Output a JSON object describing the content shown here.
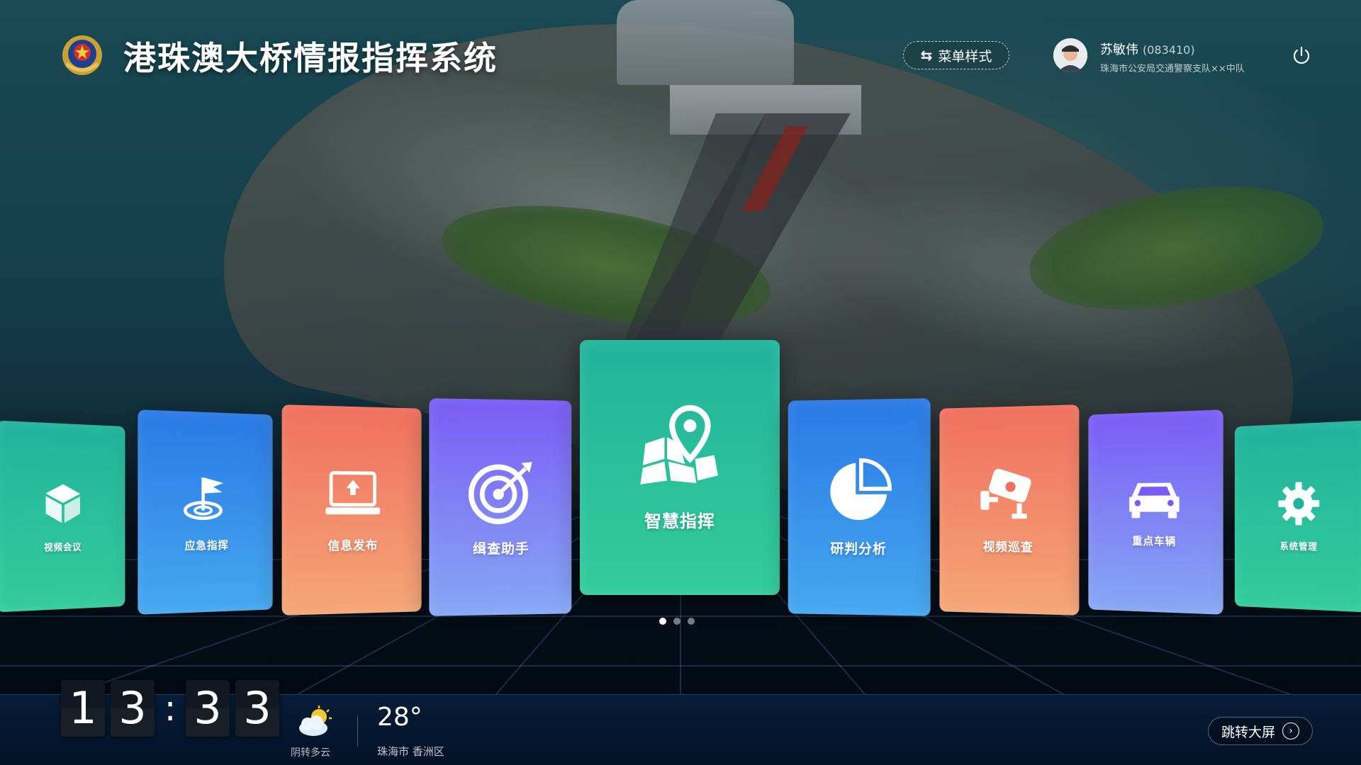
{
  "header": {
    "title": "港珠澳大桥情报指挥系统",
    "menu_style_label": "菜单样式",
    "user": {
      "name": "苏敏伟",
      "id": "(083410)",
      "department": "珠海市公安局交通警察支队××中队"
    }
  },
  "cards": [
    {
      "label": "视频会议",
      "icon": "cube-icon",
      "color": "#21b39c"
    },
    {
      "label": "应急指挥",
      "icon": "flag-target-icon",
      "color": "#2a79e4"
    },
    {
      "label": "信息发布",
      "icon": "laptop-upload-icon",
      "color": "#f0705e"
    },
    {
      "label": "缉查助手",
      "icon": "target-icon",
      "color": "#7a5cf5"
    },
    {
      "label": "智慧指挥",
      "icon": "map-pin-icon",
      "color": "#21b39c"
    },
    {
      "label": "研判分析",
      "icon": "pie-chart-icon",
      "color": "#2a79e4"
    },
    {
      "label": "视频巡查",
      "icon": "cctv-camera-icon",
      "color": "#f0705e"
    },
    {
      "label": "重点车辆",
      "icon": "car-icon",
      "color": "#7a5cf5"
    },
    {
      "label": "系统管理",
      "icon": "gear-icon",
      "color": "#21b39c"
    }
  ],
  "pagination": {
    "pages": 3,
    "active": 1
  },
  "clock": {
    "digits": [
      "1",
      "3",
      "3",
      "3"
    ],
    "separator": ":"
  },
  "weather": {
    "description": "阴转多云",
    "temperature": "28°",
    "location": "珠海市 香洲区",
    "icon": "cloudy-sun-icon"
  },
  "jump_button": {
    "label": "跳转大屏"
  },
  "colors": {
    "teal": "#21b39c",
    "blue": "#2a79e4",
    "orange": "#f0705e",
    "purple": "#7a5cf5"
  }
}
